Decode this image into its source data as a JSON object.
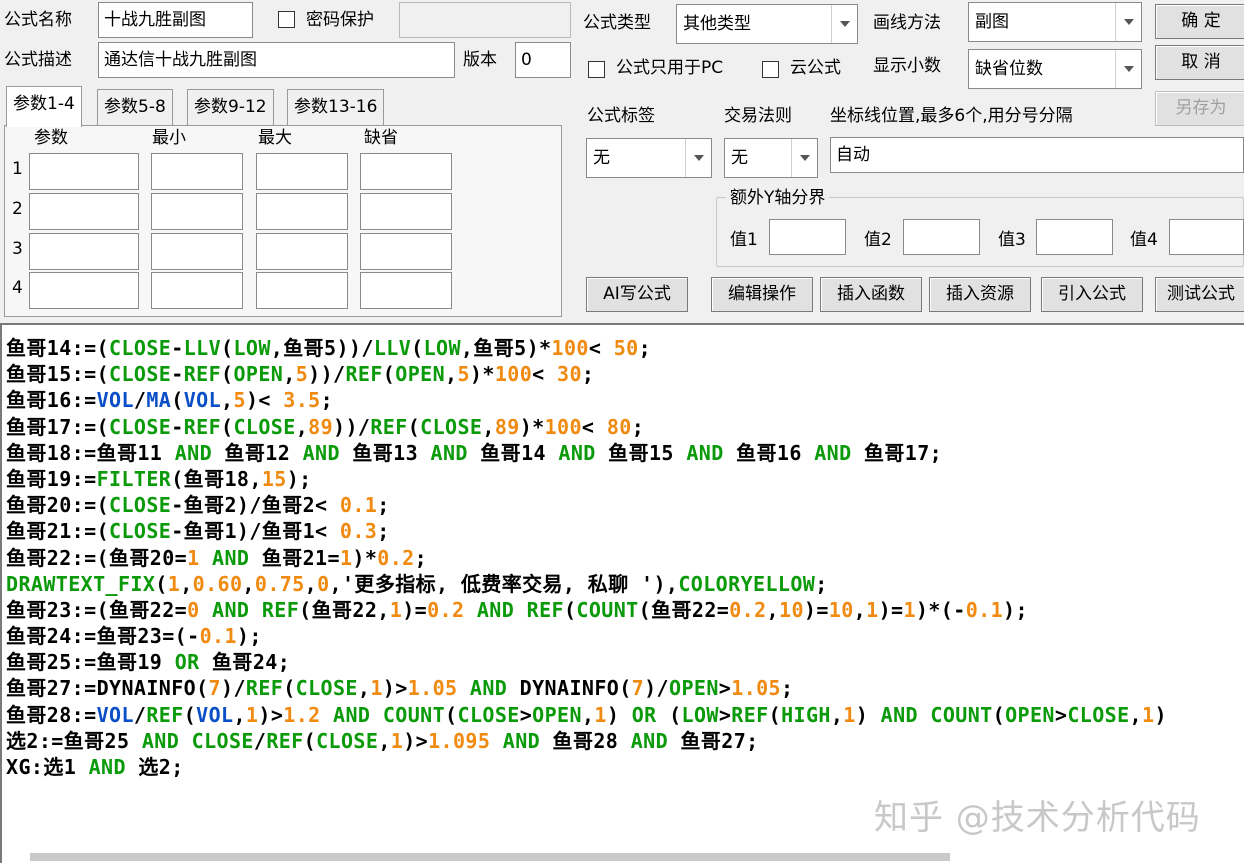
{
  "form": {
    "name_label": "公式名称",
    "name_value": "十战九胜副图",
    "password_label": "密码保护",
    "desc_label": "公式描述",
    "desc_value": "通达信十战九胜副图",
    "version_label": "版本",
    "version_value": "0",
    "type_label": "公式类型",
    "type_value": "其他类型",
    "draw_label": "画线方法",
    "draw_value": "副图",
    "pc_only_label": "公式只用于PC",
    "cloud_label": "云公式",
    "decimals_label": "显示小数",
    "decimals_value": "缺省位数",
    "tag_label": "公式标签",
    "tag_value": "无",
    "trade_label": "交易法则",
    "trade_value": "无",
    "axis_label": "坐标线位置,最多6个,用分号分隔",
    "axis_value": "自动",
    "y_group_label": "额外Y轴分界",
    "y1": "值1",
    "y2": "值2",
    "y3": "值3",
    "y4": "值4"
  },
  "buttons": {
    "ok": "确 定",
    "cancel": "取 消",
    "save_as": "另存为",
    "ai": "AI写公式",
    "edit": "编辑操作",
    "insert_func": "插入函数",
    "insert_res": "插入资源",
    "import": "引入公式",
    "test": "测试公式"
  },
  "tabs": [
    "参数1-4",
    "参数5-8",
    "参数9-12",
    "参数13-16"
  ],
  "params": {
    "headers": [
      "参数",
      "最小",
      "最大",
      "缺省"
    ],
    "rows": [
      "1",
      "2",
      "3",
      "4"
    ]
  },
  "code_lines": [
    [
      [
        "s",
        "鱼哥14:=("
      ],
      [
        "k",
        "CLOSE"
      ],
      [
        "s",
        "-"
      ],
      [
        "k",
        "LLV"
      ],
      [
        "s",
        "("
      ],
      [
        "k",
        "LOW"
      ],
      [
        "s",
        ",鱼哥5))/"
      ],
      [
        "k",
        "LLV"
      ],
      [
        "s",
        "("
      ],
      [
        "k",
        "LOW"
      ],
      [
        "s",
        ",鱼哥5)*"
      ],
      [
        "n",
        "100"
      ],
      [
        "s",
        "< "
      ],
      [
        "n",
        "50"
      ],
      [
        "s",
        ";"
      ]
    ],
    [
      [
        "s",
        "鱼哥15:=("
      ],
      [
        "k",
        "CLOSE"
      ],
      [
        "s",
        "-"
      ],
      [
        "k",
        "REF"
      ],
      [
        "s",
        "("
      ],
      [
        "k",
        "OPEN"
      ],
      [
        "s",
        ","
      ],
      [
        "n",
        "5"
      ],
      [
        "s",
        "))/"
      ],
      [
        "k",
        "REF"
      ],
      [
        "s",
        "("
      ],
      [
        "k",
        "OPEN"
      ],
      [
        "s",
        ","
      ],
      [
        "n",
        "5"
      ],
      [
        "s",
        ")*"
      ],
      [
        "n",
        "100"
      ],
      [
        "s",
        "< "
      ],
      [
        "n",
        "30"
      ],
      [
        "s",
        ";"
      ]
    ],
    [
      [
        "s",
        "鱼哥16:="
      ],
      [
        "f",
        "VOL"
      ],
      [
        "s",
        "/"
      ],
      [
        "f",
        "MA"
      ],
      [
        "s",
        "("
      ],
      [
        "f",
        "VOL"
      ],
      [
        "s",
        ","
      ],
      [
        "n",
        "5"
      ],
      [
        "s",
        ")< "
      ],
      [
        "n",
        "3.5"
      ],
      [
        "s",
        ";"
      ]
    ],
    [
      [
        "s",
        "鱼哥17:=("
      ],
      [
        "k",
        "CLOSE"
      ],
      [
        "s",
        "-"
      ],
      [
        "k",
        "REF"
      ],
      [
        "s",
        "("
      ],
      [
        "k",
        "CLOSE"
      ],
      [
        "s",
        ","
      ],
      [
        "n",
        "89"
      ],
      [
        "s",
        "))/"
      ],
      [
        "k",
        "REF"
      ],
      [
        "s",
        "("
      ],
      [
        "k",
        "CLOSE"
      ],
      [
        "s",
        ","
      ],
      [
        "n",
        "89"
      ],
      [
        "s",
        ")*"
      ],
      [
        "n",
        "100"
      ],
      [
        "s",
        "< "
      ],
      [
        "n",
        "80"
      ],
      [
        "s",
        ";"
      ]
    ],
    [
      [
        "s",
        "鱼哥18:=鱼哥11 "
      ],
      [
        "k",
        "AND"
      ],
      [
        "s",
        " 鱼哥12 "
      ],
      [
        "k",
        "AND"
      ],
      [
        "s",
        " 鱼哥13 "
      ],
      [
        "k",
        "AND"
      ],
      [
        "s",
        " 鱼哥14 "
      ],
      [
        "k",
        "AND"
      ],
      [
        "s",
        " 鱼哥15 "
      ],
      [
        "k",
        "AND"
      ],
      [
        "s",
        " 鱼哥16 "
      ],
      [
        "k",
        "AND"
      ],
      [
        "s",
        " 鱼哥17;"
      ]
    ],
    [
      [
        "s",
        "鱼哥19:="
      ],
      [
        "k",
        "FILTER"
      ],
      [
        "s",
        "(鱼哥18,"
      ],
      [
        "n",
        "15"
      ],
      [
        "s",
        ");"
      ]
    ],
    [
      [
        "s",
        "鱼哥20:=("
      ],
      [
        "k",
        "CLOSE"
      ],
      [
        "s",
        "-鱼哥2)/鱼哥2< "
      ],
      [
        "n",
        "0.1"
      ],
      [
        "s",
        ";"
      ]
    ],
    [
      [
        "s",
        "鱼哥21:=("
      ],
      [
        "k",
        "CLOSE"
      ],
      [
        "s",
        "-鱼哥1)/鱼哥1< "
      ],
      [
        "n",
        "0.3"
      ],
      [
        "s",
        ";"
      ]
    ],
    [
      [
        "s",
        "鱼哥22:=(鱼哥20="
      ],
      [
        "n",
        "1"
      ],
      [
        "s",
        " "
      ],
      [
        "k",
        "AND"
      ],
      [
        "s",
        " 鱼哥21="
      ],
      [
        "n",
        "1"
      ],
      [
        "s",
        ")*"
      ],
      [
        "n",
        "0.2"
      ],
      [
        "s",
        ";"
      ]
    ],
    [
      [
        "k",
        "DRAWTEXT_FIX"
      ],
      [
        "s",
        "("
      ],
      [
        "n",
        "1"
      ],
      [
        "s",
        ","
      ],
      [
        "n",
        "0.60"
      ],
      [
        "s",
        ","
      ],
      [
        "n",
        "0.75"
      ],
      [
        "s",
        ","
      ],
      [
        "n",
        "0"
      ],
      [
        "s",
        ",'更多指标, 低费率交易, 私聊 '),"
      ],
      [
        "k",
        "COLORYELLOW"
      ],
      [
        "s",
        ";"
      ]
    ],
    [
      [
        "s",
        "鱼哥23:=(鱼哥22="
      ],
      [
        "n",
        "0"
      ],
      [
        "s",
        " "
      ],
      [
        "k",
        "AND"
      ],
      [
        "s",
        " "
      ],
      [
        "k",
        "REF"
      ],
      [
        "s",
        "(鱼哥22,"
      ],
      [
        "n",
        "1"
      ],
      [
        "s",
        ")="
      ],
      [
        "n",
        "0.2"
      ],
      [
        "s",
        " "
      ],
      [
        "k",
        "AND"
      ],
      [
        "s",
        " "
      ],
      [
        "k",
        "REF"
      ],
      [
        "s",
        "("
      ],
      [
        "k",
        "COUNT"
      ],
      [
        "s",
        "(鱼哥22="
      ],
      [
        "n",
        "0.2"
      ],
      [
        "s",
        ","
      ],
      [
        "n",
        "10"
      ],
      [
        "s",
        ")="
      ],
      [
        "n",
        "10"
      ],
      [
        "s",
        ","
      ],
      [
        "n",
        "1"
      ],
      [
        "s",
        ")="
      ],
      [
        "n",
        "1"
      ],
      [
        "s",
        ")*(-"
      ],
      [
        "n",
        "0.1"
      ],
      [
        "s",
        ");"
      ]
    ],
    [
      [
        "s",
        "鱼哥24:=鱼哥23=(-"
      ],
      [
        "n",
        "0.1"
      ],
      [
        "s",
        ");"
      ]
    ],
    [
      [
        "s",
        "鱼哥25:=鱼哥19 "
      ],
      [
        "k",
        "OR"
      ],
      [
        "s",
        " 鱼哥24;"
      ]
    ],
    [
      [
        "s",
        "鱼哥27:=DYNAINFO("
      ],
      [
        "n",
        "7"
      ],
      [
        "s",
        ")/"
      ],
      [
        "k",
        "REF"
      ],
      [
        "s",
        "("
      ],
      [
        "k",
        "CLOSE"
      ],
      [
        "s",
        ","
      ],
      [
        "n",
        "1"
      ],
      [
        "s",
        ")>"
      ],
      [
        "n",
        "1.05"
      ],
      [
        "s",
        " "
      ],
      [
        "k",
        "AND"
      ],
      [
        "s",
        " DYNAINFO("
      ],
      [
        "n",
        "7"
      ],
      [
        "s",
        ")/"
      ],
      [
        "k",
        "OPEN"
      ],
      [
        "s",
        ">"
      ],
      [
        "n",
        "1.05"
      ],
      [
        "s",
        ";"
      ]
    ],
    [
      [
        "s",
        "鱼哥28:="
      ],
      [
        "f",
        "VOL"
      ],
      [
        "s",
        "/"
      ],
      [
        "k",
        "REF"
      ],
      [
        "s",
        "("
      ],
      [
        "f",
        "VOL"
      ],
      [
        "s",
        ","
      ],
      [
        "n",
        "1"
      ],
      [
        "s",
        ")>"
      ],
      [
        "n",
        "1.2"
      ],
      [
        "s",
        " "
      ],
      [
        "k",
        "AND"
      ],
      [
        "s",
        " "
      ],
      [
        "k",
        "COUNT"
      ],
      [
        "s",
        "("
      ],
      [
        "k",
        "CLOSE"
      ],
      [
        "s",
        ">"
      ],
      [
        "k",
        "OPEN"
      ],
      [
        "s",
        ","
      ],
      [
        "n",
        "1"
      ],
      [
        "s",
        ") "
      ],
      [
        "k",
        "OR"
      ],
      [
        "s",
        " ("
      ],
      [
        "k",
        "LOW"
      ],
      [
        "s",
        ">"
      ],
      [
        "k",
        "REF"
      ],
      [
        "s",
        "("
      ],
      [
        "k",
        "HIGH"
      ],
      [
        "s",
        ","
      ],
      [
        "n",
        "1"
      ],
      [
        "s",
        ") "
      ],
      [
        "k",
        "AND"
      ],
      [
        "s",
        " "
      ],
      [
        "k",
        "COUNT"
      ],
      [
        "s",
        "("
      ],
      [
        "k",
        "OPEN"
      ],
      [
        "s",
        ">"
      ],
      [
        "k",
        "CLOSE"
      ],
      [
        "s",
        ","
      ],
      [
        "n",
        "1"
      ],
      [
        "s",
        ")"
      ]
    ],
    [
      [
        "s",
        "选2:=鱼哥25 "
      ],
      [
        "k",
        "AND"
      ],
      [
        "s",
        " "
      ],
      [
        "k",
        "CLOSE"
      ],
      [
        "s",
        "/"
      ],
      [
        "k",
        "REF"
      ],
      [
        "s",
        "("
      ],
      [
        "k",
        "CLOSE"
      ],
      [
        "s",
        ","
      ],
      [
        "n",
        "1"
      ],
      [
        "s",
        ")>"
      ],
      [
        "n",
        "1.095"
      ],
      [
        "s",
        " "
      ],
      [
        "k",
        "AND"
      ],
      [
        "s",
        " 鱼哥28 "
      ],
      [
        "k",
        "AND"
      ],
      [
        "s",
        " 鱼哥27;"
      ]
    ],
    [
      [
        "s",
        "XG:选1 "
      ],
      [
        "k",
        "AND"
      ],
      [
        "s",
        " 选2;"
      ]
    ]
  ],
  "watermark": "知乎 @技术分析代码",
  "colors": {
    "keyword": "#0a9a0a",
    "function": "#0a4fc7",
    "number": "#f08a10"
  }
}
